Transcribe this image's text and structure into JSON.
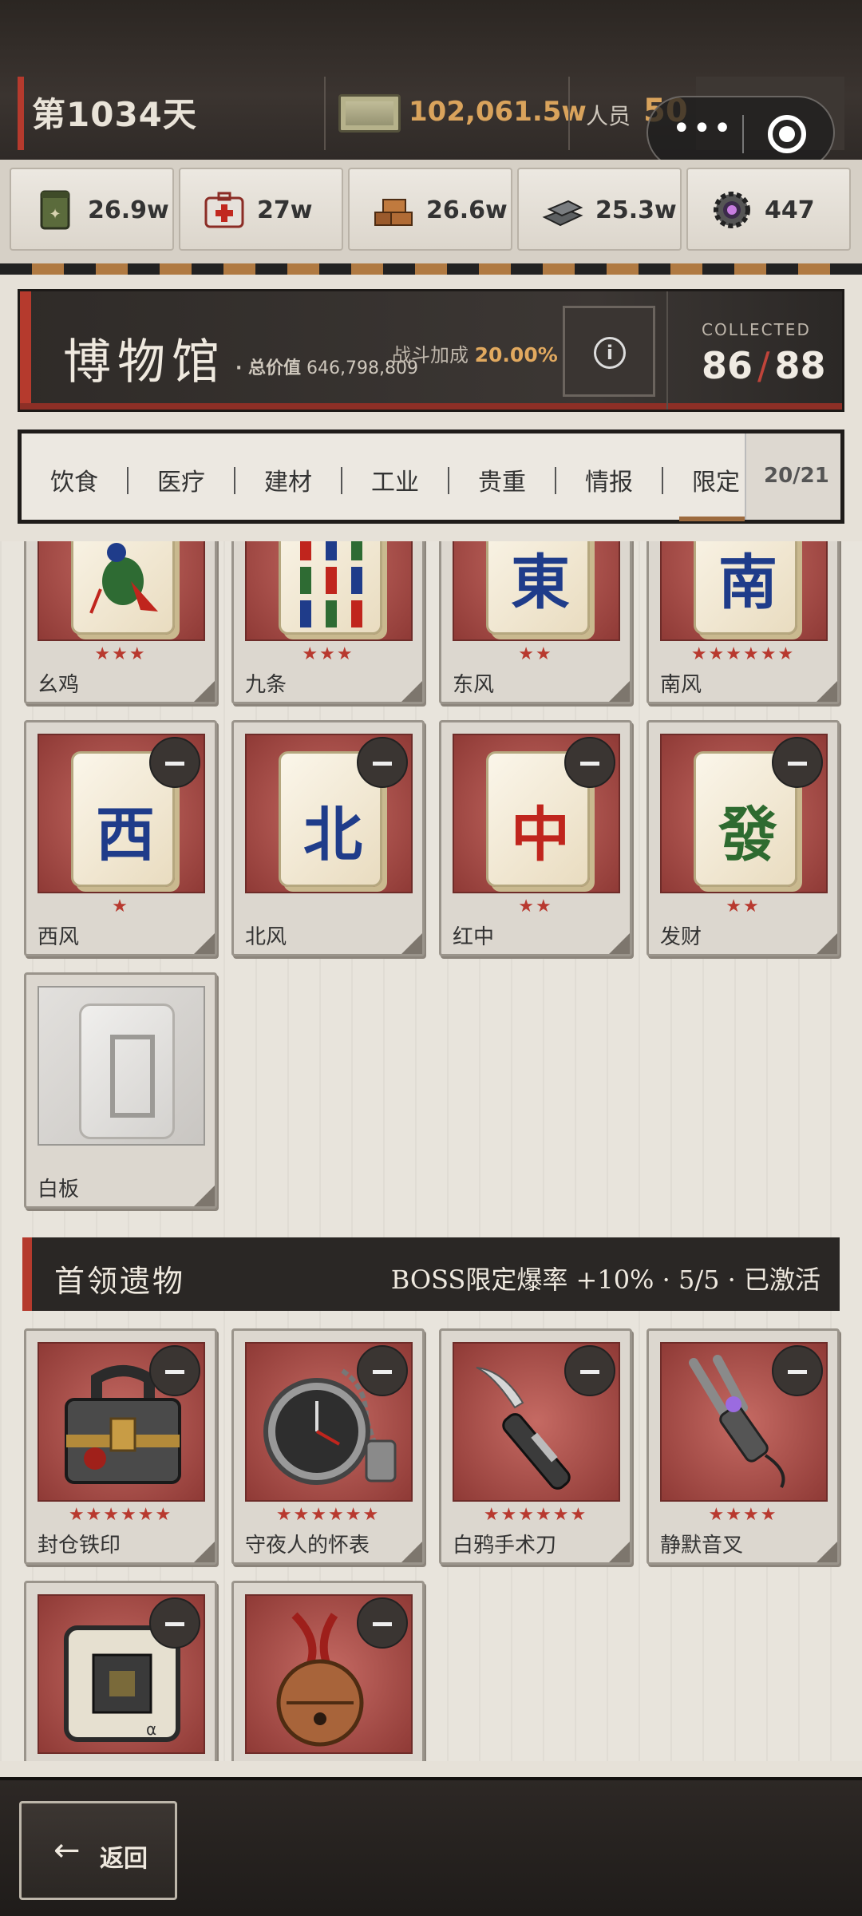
{
  "header": {
    "day": "第1034天",
    "money": "102,061.5w",
    "staff_label": "人员",
    "staff_value": "50"
  },
  "resources": [
    {
      "icon": "food-can-icon",
      "value": "26.9w"
    },
    {
      "icon": "medkit-icon",
      "value": "27w"
    },
    {
      "icon": "wood-icon",
      "value": "26.6w"
    },
    {
      "icon": "metal-icon",
      "value": "25.3w"
    },
    {
      "icon": "gear-core-icon",
      "value": "447"
    }
  ],
  "museum": {
    "title": "博物馆",
    "total_value_label": "· 总价值",
    "total_value": "646,798,809",
    "bonus_label": "战斗加成",
    "bonus_value": "20.00%",
    "info": "i",
    "collected_label": "COLLECTED",
    "collected": "86",
    "total": "88"
  },
  "tabs": {
    "items": [
      "饮食",
      "医疗",
      "建材",
      "工业",
      "贵重",
      "情报",
      "限定"
    ],
    "active": "限定",
    "count": "20/21"
  },
  "mahjong_items": [
    {
      "name": "幺鸡",
      "stars": "★★★",
      "glyph": "",
      "color": "#2d6b33"
    },
    {
      "name": "九条",
      "stars": "★★★",
      "glyph": "",
      "color": "#2d6b33"
    },
    {
      "name": "东风",
      "stars": "★★",
      "glyph": "東",
      "color": "#1f3c8a"
    },
    {
      "name": "南风",
      "stars": "★★★★★★",
      "glyph": "南",
      "color": "#1f3c8a"
    },
    {
      "name": "西风",
      "stars": "★",
      "glyph": "西",
      "color": "#1f3c8a"
    },
    {
      "name": "北风",
      "stars": "",
      "glyph": "北",
      "color": "#1f3c8a"
    },
    {
      "name": "红中",
      "stars": "★★",
      "glyph": "中",
      "color": "#c0251d"
    },
    {
      "name": "发财",
      "stars": "★★",
      "glyph": "發",
      "color": "#2e6b30"
    },
    {
      "name": "白板",
      "stars": "",
      "glyph": "",
      "color": "#9c9a96"
    }
  ],
  "boss_section": {
    "title": "首领遗物",
    "stat": "BOSS限定爆率 +10% · 5/5 · 已激活"
  },
  "boss_items": [
    {
      "name": "封仓铁印",
      "stars": "★★★★★★"
    },
    {
      "name": "守夜人的怀表",
      "stars": "★★★★★★"
    },
    {
      "name": "白鸦手术刀",
      "stars": "★★★★★★"
    },
    {
      "name": "静默音叉",
      "stars": "★★★★"
    },
    {
      "name": "",
      "stars": ""
    },
    {
      "name": "",
      "stars": ""
    }
  ],
  "footer": {
    "back_label": "返回"
  }
}
